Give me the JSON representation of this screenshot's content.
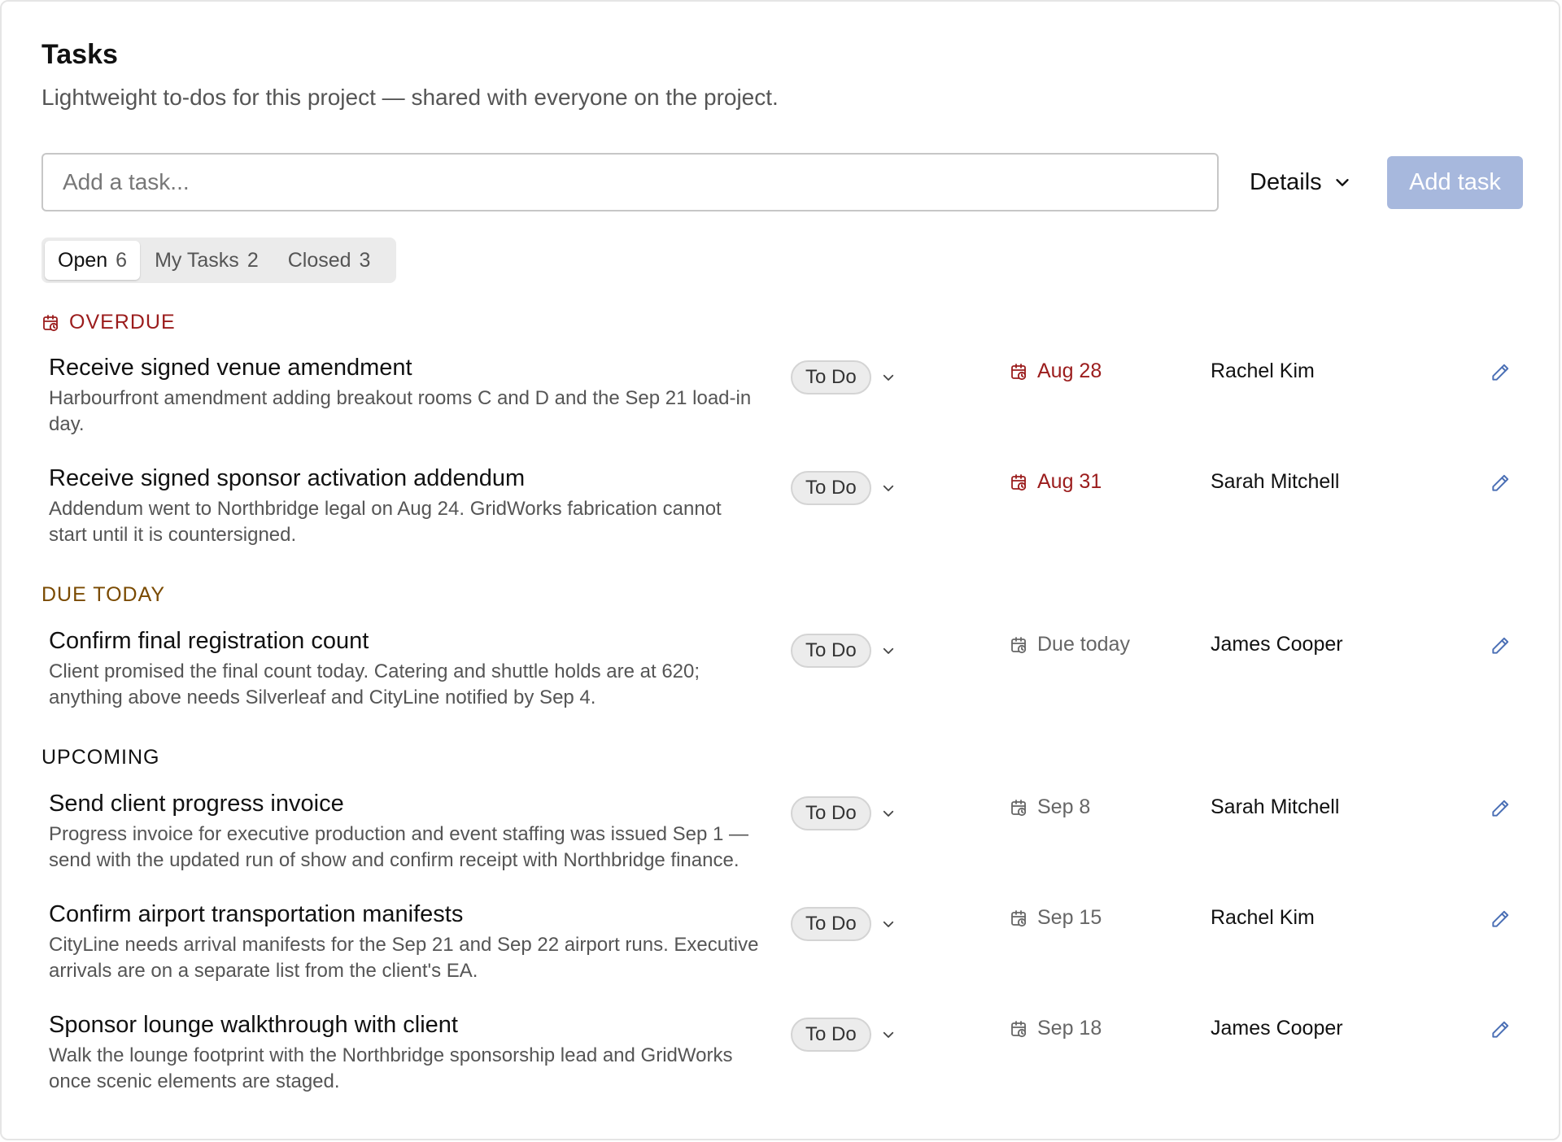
{
  "header": {
    "title": "Tasks",
    "subtitle": "Lightweight to-dos for this project — shared with everyone on the project."
  },
  "composer": {
    "placeholder": "Add a task...",
    "details_label": "Details",
    "add_label": "Add task"
  },
  "tabs": [
    {
      "label": "Open",
      "count": "6",
      "active": true
    },
    {
      "label": "My Tasks",
      "count": "2",
      "active": false
    },
    {
      "label": "Closed",
      "count": "3",
      "active": false
    }
  ],
  "colors": {
    "overdue": "#9b1c1c",
    "due_today": "#7a4a00",
    "upcoming": "#111111",
    "edit_icon": "#4a6fb5",
    "add_button": "#a7b8dd"
  },
  "sections": {
    "overdue": {
      "label": "OVERDUE",
      "icon": "calendar-clock-icon"
    },
    "due_today": {
      "label": "DUE TODAY"
    },
    "upcoming": {
      "label": "UPCOMING"
    }
  },
  "tasks": [
    {
      "title": "Receive signed venue amendment",
      "description": "Harbourfront amendment adding breakout rooms C and D and the Sep 21 load-in day.",
      "status": "To Do",
      "due": "Aug 28",
      "assignee": "Rachel Kim"
    },
    {
      "title": "Receive signed sponsor activation addendum",
      "description": "Addendum went to Northbridge legal on Aug 24. GridWorks fabrication cannot start until it is countersigned.",
      "status": "To Do",
      "due": "Aug 31",
      "assignee": "Sarah Mitchell"
    },
    {
      "title": "Confirm final registration count",
      "description": "Client promised the final count today. Catering and shuttle holds are at 620; anything above needs Silverleaf and CityLine notified by Sep 4.",
      "status": "To Do",
      "due": "Due today",
      "assignee": "James Cooper"
    },
    {
      "title": "Send client progress invoice",
      "description": "Progress invoice for executive production and event staffing was issued Sep 1 — send with the updated run of show and confirm receipt with Northbridge finance.",
      "status": "To Do",
      "due": "Sep 8",
      "assignee": "Sarah Mitchell"
    },
    {
      "title": "Confirm airport transportation manifests",
      "description": "CityLine needs arrival manifests for the Sep 21 and Sep 22 airport runs. Executive arrivals are on a separate list from the client's EA.",
      "status": "To Do",
      "due": "Sep 15",
      "assignee": "Rachel Kim"
    },
    {
      "title": "Sponsor lounge walkthrough with client",
      "description": "Walk the lounge footprint with the Northbridge sponsorship lead and GridWorks once scenic elements are staged.",
      "status": "To Do",
      "due": "Sep 18",
      "assignee": "James Cooper"
    }
  ]
}
